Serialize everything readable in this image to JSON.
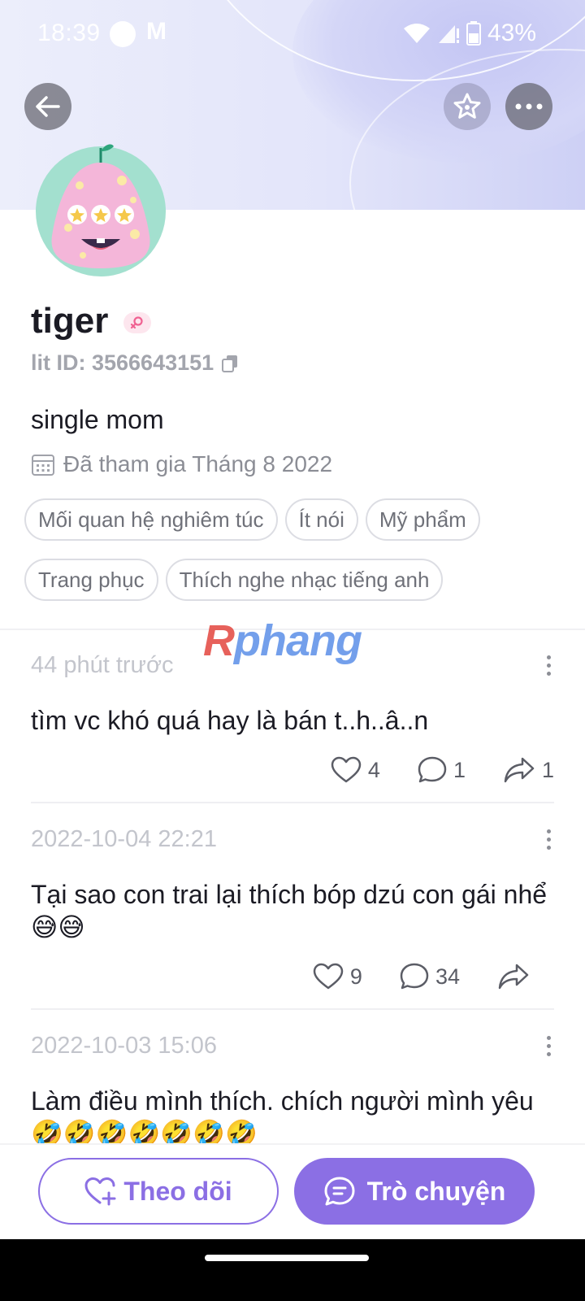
{
  "status_bar": {
    "time": "18:39",
    "battery": "43%"
  },
  "header": {
    "back_icon": "arrow-left-icon",
    "star_icon": "star-icon",
    "more_icon": "more-horizontal-icon"
  },
  "profile": {
    "name": "tiger",
    "lit_id": "lit ID: 3566643151",
    "bio": "single mom",
    "joined": "Đã tham gia Tháng 8 2022",
    "tags": [
      "Mối quan hệ nghiêm túc",
      "Ít nói",
      "Mỹ phẩm",
      "Trang phục",
      "Thích nghe nhạc tiếng anh"
    ]
  },
  "watermark": {
    "first": "R",
    "rest": "phang"
  },
  "posts": [
    {
      "time": "44 phút trước",
      "text": "tìm vc khó quá hay là bán t..h..â..n",
      "likes": "4",
      "comments": "1",
      "shares": "1"
    },
    {
      "time": "2022-10-04 22:21",
      "text": "Tại sao con trai lại thích bóp dzú con gái nhể 😅😅",
      "likes": "9",
      "comments": "34",
      "shares": ""
    },
    {
      "time": "2022-10-03 15:06",
      "text": "Làm điều mình thích. chích người mình yêu 🤣🤣🤣🤣🤣🤣🤣"
    }
  ],
  "actions": {
    "follow": "Theo dõi",
    "chat": "Trò chuyện"
  },
  "colors": {
    "accent": "#8b6fe4",
    "header_bg": "#e3e5fa"
  }
}
